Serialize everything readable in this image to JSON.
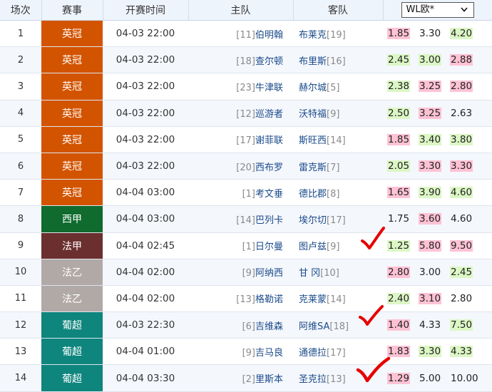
{
  "header": {
    "col_index": "场次",
    "col_league": "赛事",
    "col_time": "开赛时间",
    "col_home": "主队",
    "col_away": "客队",
    "odds_select": "WL欧*",
    "odds_select_icon": "chevron-down-icon"
  },
  "colors": {
    "league_premier": "#d35400",
    "league_laliga": "#0f6b2e",
    "league_ligue1": "#6b2f2f",
    "league_ligue2": "#b1a9a6",
    "league_portugal": "#0e857d",
    "odds_highlight_red": "#ffc2d4",
    "odds_highlight_green": "#dcf7c5",
    "check_mark": "#e60000"
  },
  "matches": [
    {
      "num": "1",
      "league": "英冠",
      "color": "#d35400",
      "time": "04-03 22:00",
      "home_rank": "[11]",
      "home": "伯明翰",
      "away": "布莱克",
      "away_rank": "[19]",
      "odds": [
        {
          "v": "1.85",
          "hl": "red"
        },
        {
          "v": "3.30",
          "hl": ""
        },
        {
          "v": "4.20",
          "hl": "green"
        }
      ]
    },
    {
      "num": "2",
      "league": "英冠",
      "color": "#d35400",
      "time": "04-03 22:00",
      "home_rank": "[18]",
      "home": "查尔顿",
      "away": "布里斯",
      "away_rank": "[16]",
      "odds": [
        {
          "v": "2.45",
          "hl": "green"
        },
        {
          "v": "3.00",
          "hl": "green"
        },
        {
          "v": "2.88",
          "hl": "red"
        }
      ]
    },
    {
      "num": "3",
      "league": "英冠",
      "color": "#d35400",
      "time": "04-03 22:00",
      "home_rank": "[23]",
      "home": "牛津联",
      "away": "赫尔城",
      "away_rank": "[5]",
      "odds": [
        {
          "v": "2.38",
          "hl": "green"
        },
        {
          "v": "3.25",
          "hl": "red"
        },
        {
          "v": "2.80",
          "hl": "red"
        }
      ]
    },
    {
      "num": "4",
      "league": "英冠",
      "color": "#d35400",
      "time": "04-03 22:00",
      "home_rank": "[12]",
      "home": "巡游者",
      "away": "沃特福",
      "away_rank": "[9]",
      "odds": [
        {
          "v": "2.50",
          "hl": "green"
        },
        {
          "v": "3.25",
          "hl": "red"
        },
        {
          "v": "2.63",
          "hl": ""
        }
      ]
    },
    {
      "num": "5",
      "league": "英冠",
      "color": "#d35400",
      "time": "04-03 22:00",
      "home_rank": "[17]",
      "home": "谢菲联",
      "away": "斯旺西",
      "away_rank": "[14]",
      "odds": [
        {
          "v": "1.85",
          "hl": "red"
        },
        {
          "v": "3.40",
          "hl": "green"
        },
        {
          "v": "3.80",
          "hl": "green"
        }
      ]
    },
    {
      "num": "6",
      "league": "英冠",
      "color": "#d35400",
      "time": "04-03 22:00",
      "home_rank": "[20]",
      "home": "西布罗",
      "away": "雷克斯",
      "away_rank": "[7]",
      "odds": [
        {
          "v": "2.05",
          "hl": "green"
        },
        {
          "v": "3.30",
          "hl": "red"
        },
        {
          "v": "3.30",
          "hl": "red"
        }
      ]
    },
    {
      "num": "7",
      "league": "英冠",
      "color": "#d35400",
      "time": "04-04 03:00",
      "home_rank": "[1]",
      "home": "考文垂",
      "away": "德比郡",
      "away_rank": "[8]",
      "odds": [
        {
          "v": "1.65",
          "hl": "red"
        },
        {
          "v": "3.90",
          "hl": "green"
        },
        {
          "v": "4.60",
          "hl": "green"
        }
      ]
    },
    {
      "num": "8",
      "league": "西甲",
      "color": "#0f6b2e",
      "time": "04-04 03:00",
      "home_rank": "[14]",
      "home": "巴列卡",
      "away": "埃尔切",
      "away_rank": "[17]",
      "odds": [
        {
          "v": "1.75",
          "hl": ""
        },
        {
          "v": "3.60",
          "hl": "red"
        },
        {
          "v": "4.60",
          "hl": ""
        }
      ]
    },
    {
      "num": "9",
      "league": "法甲",
      "color": "#6b2f2f",
      "time": "04-04 02:45",
      "home_rank": "[1]",
      "home": "日尔曼",
      "away": "图卢兹",
      "away_rank": "[9]",
      "odds": [
        {
          "v": "1.25",
          "hl": "green"
        },
        {
          "v": "5.80",
          "hl": "red"
        },
        {
          "v": "9.50",
          "hl": "red"
        }
      ]
    },
    {
      "num": "10",
      "league": "法乙",
      "color": "#b1a9a6",
      "time": "04-04 02:00",
      "home_rank": "[9]",
      "home": "阿纳西",
      "away": "甘 冈",
      "away_rank": "[10]",
      "odds": [
        {
          "v": "2.80",
          "hl": "red"
        },
        {
          "v": "3.00",
          "hl": ""
        },
        {
          "v": "2.45",
          "hl": "green"
        }
      ]
    },
    {
      "num": "11",
      "league": "法乙",
      "color": "#b1a9a6",
      "time": "04-04 02:00",
      "home_rank": "[13]",
      "home": "格勒诺",
      "away": "克莱蒙",
      "away_rank": "[14]",
      "odds": [
        {
          "v": "2.40",
          "hl": "green"
        },
        {
          "v": "3.10",
          "hl": "red"
        },
        {
          "v": "2.80",
          "hl": ""
        }
      ]
    },
    {
      "num": "12",
      "league": "葡超",
      "color": "#0e857d",
      "time": "04-03 22:30",
      "home_rank": "[6]",
      "home": "吉维森",
      "away": "阿维SA",
      "away_rank": "[18]",
      "odds": [
        {
          "v": "1.40",
          "hl": "red"
        },
        {
          "v": "4.33",
          "hl": ""
        },
        {
          "v": "7.50",
          "hl": "green"
        }
      ]
    },
    {
      "num": "13",
      "league": "葡超",
      "color": "#0e857d",
      "time": "04-04 01:00",
      "home_rank": "[9]",
      "home": "吉马良",
      "away": "通德拉",
      "away_rank": "[17]",
      "odds": [
        {
          "v": "1.83",
          "hl": "red"
        },
        {
          "v": "3.30",
          "hl": "green"
        },
        {
          "v": "4.33",
          "hl": "green"
        }
      ]
    },
    {
      "num": "14",
      "league": "葡超",
      "color": "#0e857d",
      "time": "04-04 03:30",
      "home_rank": "[2]",
      "home": "里斯本",
      "away": "圣克拉",
      "away_rank": "[13]",
      "odds": [
        {
          "v": "1.29",
          "hl": "red"
        },
        {
          "v": "5.00",
          "hl": ""
        },
        {
          "v": "10.00",
          "hl": ""
        }
      ]
    }
  ]
}
